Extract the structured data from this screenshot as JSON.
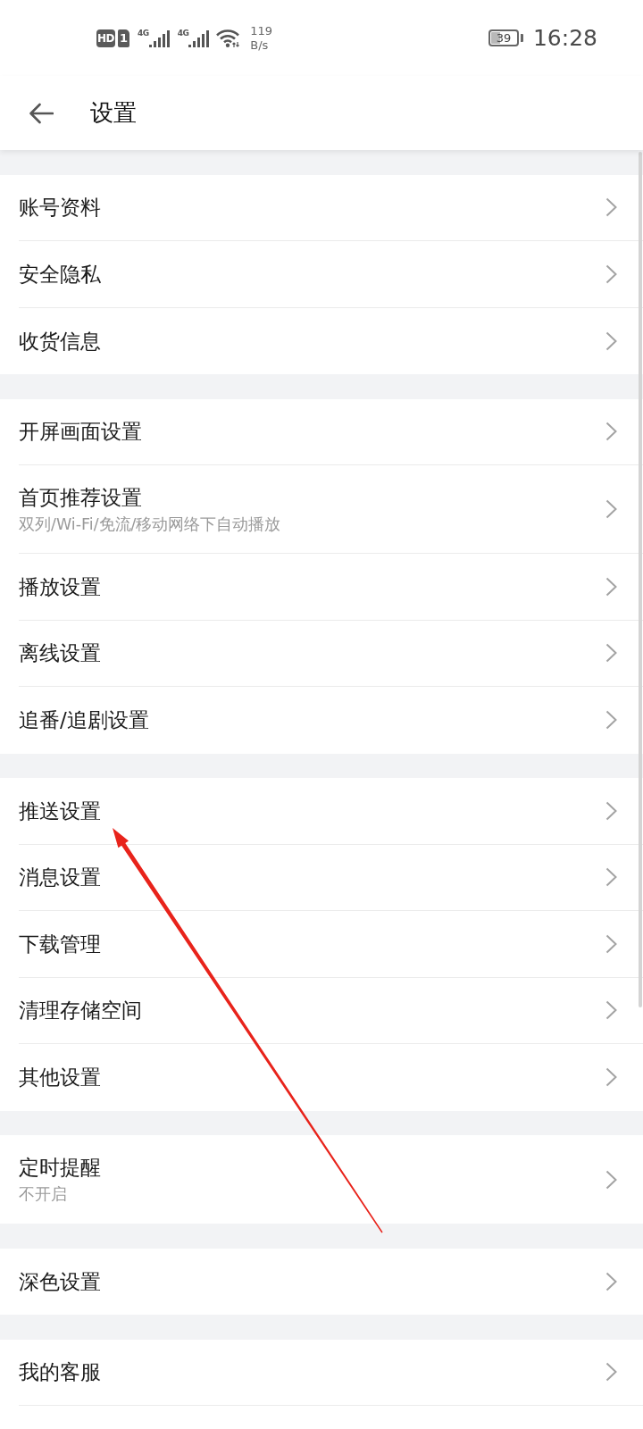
{
  "status_bar": {
    "hd_badge": "HD",
    "sim_slot": "1",
    "signals": [
      {
        "network": "4G"
      },
      {
        "network": "4G"
      }
    ],
    "speed_value": "119",
    "speed_unit": "B/s",
    "battery": "39",
    "time": "16:28"
  },
  "header": {
    "title": "设置"
  },
  "groups": [
    {
      "items": [
        {
          "title": "账号资料"
        },
        {
          "title": "安全隐私"
        },
        {
          "title": "收货信息"
        }
      ]
    },
    {
      "items": [
        {
          "title": "开屏画面设置"
        },
        {
          "title": "首页推荐设置",
          "subtitle": "双列/Wi-Fi/免流/移动网络下自动播放"
        },
        {
          "title": "播放设置"
        },
        {
          "title": "离线设置"
        },
        {
          "title": "追番/追剧设置"
        }
      ]
    },
    {
      "items": [
        {
          "title": "推送设置"
        },
        {
          "title": "消息设置"
        },
        {
          "title": "下载管理"
        },
        {
          "title": "清理存储空间"
        },
        {
          "title": "其他设置"
        }
      ]
    },
    {
      "items": [
        {
          "title": "定时提醒",
          "subtitle": "不开启"
        }
      ]
    },
    {
      "items": [
        {
          "title": "深色设置"
        }
      ]
    },
    {
      "items": [
        {
          "title": "我的客服"
        }
      ]
    }
  ],
  "annotations": [
    {
      "kind": "arrow"
    }
  ]
}
